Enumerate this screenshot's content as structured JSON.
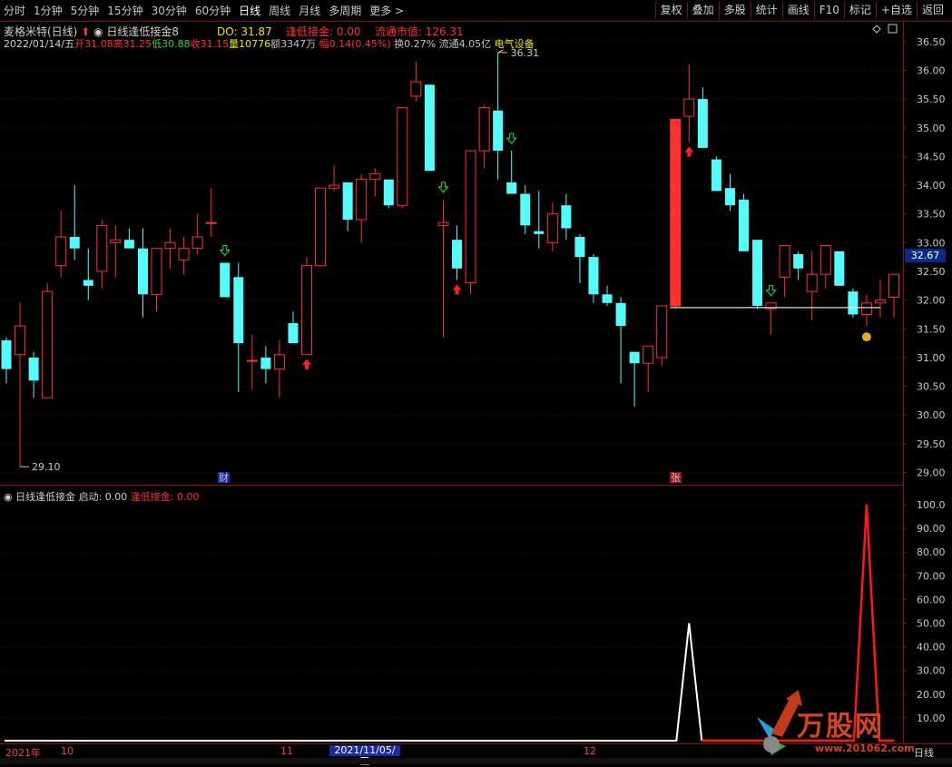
{
  "toolbar": {
    "left_items": [
      "分时",
      "1分钟",
      "5分钟",
      "15分钟",
      "30分钟",
      "60分钟",
      "日线",
      "周线",
      "月线",
      "多周期",
      "更多 >"
    ],
    "active": "日线",
    "right_items": [
      "复权",
      "叠加",
      "多股",
      "统计",
      "画线",
      "F10",
      "标记",
      "+自选",
      "返回"
    ]
  },
  "info": {
    "stock_title": "麦格米特(日线)",
    "indicator_name": "日线逢低接金8",
    "do_label": "DO: 31.87",
    "fdjj_label": "逢低接金: 0.00",
    "mktcap_label": "流通市值: 126.31",
    "date": "2022/01/14/五",
    "open": "开31.08",
    "high": "高31.25",
    "low": "低30.88",
    "close": "收31.15",
    "volume": "量10776",
    "amount": "额3347万",
    "change": "幅0.14(0.45%)",
    "turnover": "换0.27%",
    "float": "流通4.05亿",
    "sector": "电气设备"
  },
  "sub_info": {
    "name": "日线逢低接金",
    "start_label": "启动: 0.00",
    "fdjj_label": "逢低接金: 0.00"
  },
  "price_axis": [
    "36.50",
    "36.00",
    "35.50",
    "35.00",
    "34.50",
    "34.00",
    "33.50",
    "33.00",
    "32.50",
    "32.00",
    "31.50",
    "31.00",
    "30.50",
    "30.00",
    "29.50",
    "29.00"
  ],
  "current_price": "32.67",
  "high_mark": "36.31",
  "low_mark": "29.10",
  "sub_axis": [
    "100.0",
    "90.00",
    "80.00",
    "70.00",
    "60.00",
    "50.00",
    "40.00",
    "30.00",
    "20.00",
    "10.00"
  ],
  "markers": {
    "cai": "财",
    "zhang": "张"
  },
  "date_axis": {
    "year": "2021年",
    "m10": "10",
    "m11": "11",
    "highlight": "2021/11/05/五",
    "m12": "12",
    "period": "日线"
  },
  "watermark": {
    "text": "万股网",
    "url": "www.201062.com"
  },
  "colors": {
    "up": "#ff3030",
    "down": "#54fcfc",
    "grid": "#6a0000"
  },
  "chart_data": {
    "type": "candlestick",
    "ylim": [
      28.85,
      36.75
    ],
    "candles": [
      {
        "o": 31.3,
        "h": 31.35,
        "l": 30.55,
        "c": 30.8
      },
      {
        "o": 31.05,
        "h": 31.95,
        "l": 29.1,
        "c": 31.55
      },
      {
        "o": 31.0,
        "h": 31.1,
        "l": 30.3,
        "c": 30.6
      },
      {
        "o": 30.3,
        "h": 32.3,
        "l": 30.3,
        "c": 32.15
      },
      {
        "o": 32.6,
        "h": 33.55,
        "l": 32.4,
        "c": 33.1
      },
      {
        "o": 33.1,
        "h": 34.0,
        "l": 32.7,
        "c": 32.9
      },
      {
        "o": 32.35,
        "h": 32.9,
        "l": 32.0,
        "c": 32.25
      },
      {
        "o": 32.5,
        "h": 33.4,
        "l": 32.2,
        "c": 33.3
      },
      {
        "o": 33.0,
        "h": 33.3,
        "l": 32.4,
        "c": 33.05
      },
      {
        "o": 33.05,
        "h": 33.25,
        "l": 32.9,
        "c": 32.9
      },
      {
        "o": 32.9,
        "h": 33.25,
        "l": 31.7,
        "c": 32.1
      },
      {
        "o": 32.1,
        "h": 32.8,
        "l": 31.8,
        "c": 32.9
      },
      {
        "o": 32.9,
        "h": 33.25,
        "l": 32.55,
        "c": 33.0
      },
      {
        "o": 32.7,
        "h": 33.1,
        "l": 32.45,
        "c": 32.9
      },
      {
        "o": 32.9,
        "h": 33.5,
        "l": 32.8,
        "c": 33.1
      },
      {
        "o": 33.35,
        "h": 33.95,
        "l": 33.1,
        "c": 33.35
      },
      {
        "o": 32.65,
        "h": 32.65,
        "l": 32.05,
        "c": 32.05
      },
      {
        "o": 32.4,
        "h": 32.65,
        "l": 30.4,
        "c": 31.25
      },
      {
        "o": 30.95,
        "h": 31.4,
        "l": 30.45,
        "c": 30.95
      },
      {
        "o": 31.0,
        "h": 31.2,
        "l": 30.55,
        "c": 30.8
      },
      {
        "o": 30.8,
        "h": 31.3,
        "l": 30.3,
        "c": 31.05
      },
      {
        "o": 31.6,
        "h": 31.8,
        "l": 31.35,
        "c": 31.25
      },
      {
        "o": 31.05,
        "h": 32.75,
        "l": 31.05,
        "c": 32.6
      },
      {
        "o": 32.6,
        "h": 33.95,
        "l": 32.6,
        "c": 33.95
      },
      {
        "o": 33.95,
        "h": 34.35,
        "l": 33.9,
        "c": 34.0
      },
      {
        "o": 34.05,
        "h": 34.05,
        "l": 33.2,
        "c": 33.4
      },
      {
        "o": 33.4,
        "h": 34.2,
        "l": 33.0,
        "c": 34.1
      },
      {
        "o": 34.1,
        "h": 34.3,
        "l": 33.8,
        "c": 34.2
      },
      {
        "o": 34.1,
        "h": 34.1,
        "l": 33.6,
        "c": 33.65
      },
      {
        "o": 33.65,
        "h": 34.5,
        "l": 33.6,
        "c": 35.35
      },
      {
        "o": 35.55,
        "h": 36.15,
        "l": 35.45,
        "c": 35.8
      },
      {
        "o": 35.75,
        "h": 35.75,
        "l": 34.25,
        "c": 34.25
      },
      {
        "o": 33.3,
        "h": 33.75,
        "l": 31.35,
        "c": 33.35
      },
      {
        "o": 33.05,
        "h": 33.3,
        "l": 32.35,
        "c": 32.55
      },
      {
        "o": 32.3,
        "h": 33.5,
        "l": 32.1,
        "c": 34.6
      },
      {
        "o": 34.6,
        "h": 35.4,
        "l": 34.3,
        "c": 35.35
      },
      {
        "o": 35.3,
        "h": 36.31,
        "l": 34.1,
        "c": 34.6
      },
      {
        "o": 34.05,
        "h": 34.6,
        "l": 33.9,
        "c": 33.85
      },
      {
        "o": 33.85,
        "h": 34.0,
        "l": 33.15,
        "c": 33.3
      },
      {
        "o": 33.2,
        "h": 33.9,
        "l": 32.9,
        "c": 33.15
      },
      {
        "o": 33.0,
        "h": 33.7,
        "l": 32.85,
        "c": 33.5
      },
      {
        "o": 33.65,
        "h": 33.85,
        "l": 33.05,
        "c": 33.25
      },
      {
        "o": 33.1,
        "h": 33.15,
        "l": 32.3,
        "c": 32.75
      },
      {
        "o": 32.75,
        "h": 32.8,
        "l": 31.95,
        "c": 32.1
      },
      {
        "o": 32.1,
        "h": 32.25,
        "l": 31.9,
        "c": 31.95
      },
      {
        "o": 31.95,
        "h": 32.05,
        "l": 30.55,
        "c": 31.55
      },
      {
        "o": 31.1,
        "h": 31.1,
        "l": 30.15,
        "c": 30.9
      },
      {
        "o": 30.9,
        "h": 31.2,
        "l": 30.4,
        "c": 31.2
      },
      {
        "o": 31.0,
        "h": 31.75,
        "l": 30.85,
        "c": 31.9
      },
      {
        "o": 31.9,
        "h": 35.15,
        "l": 31.85,
        "c": 35.15
      },
      {
        "o": 35.2,
        "h": 36.1,
        "l": 34.75,
        "c": 35.5
      },
      {
        "o": 35.5,
        "h": 35.7,
        "l": 34.65,
        "c": 34.65
      },
      {
        "o": 34.45,
        "h": 34.5,
        "l": 33.9,
        "c": 33.9
      },
      {
        "o": 33.95,
        "h": 34.2,
        "l": 33.55,
        "c": 33.65
      },
      {
        "o": 33.75,
        "h": 33.85,
        "l": 32.85,
        "c": 32.85
      },
      {
        "o": 33.05,
        "h": 33.05,
        "l": 31.85,
        "c": 31.9
      },
      {
        "o": 31.85,
        "h": 31.95,
        "l": 31.4,
        "c": 31.95
      },
      {
        "o": 32.4,
        "h": 32.75,
        "l": 32.05,
        "c": 32.95
      },
      {
        "o": 32.8,
        "h": 32.85,
        "l": 32.35,
        "c": 32.55
      },
      {
        "o": 32.15,
        "h": 32.85,
        "l": 31.65,
        "c": 32.45
      },
      {
        "o": 32.45,
        "h": 32.95,
        "l": 32.2,
        "c": 32.95
      },
      {
        "o": 32.85,
        "h": 32.85,
        "l": 32.25,
        "c": 32.25
      },
      {
        "o": 32.15,
        "h": 32.2,
        "l": 31.7,
        "c": 31.75
      },
      {
        "o": 31.75,
        "h": 32.1,
        "l": 31.55,
        "c": 31.95
      },
      {
        "o": 31.95,
        "h": 32.35,
        "l": 31.7,
        "c": 32.0
      },
      {
        "o": 32.05,
        "h": 32.45,
        "l": 31.7,
        "c": 32.45
      }
    ],
    "buy_signals": [
      22,
      33,
      50
    ],
    "sell_signals": [
      16,
      32,
      37,
      56
    ],
    "support_line": {
      "value": 31.87,
      "from": 49,
      "to": 64
    },
    "indicator": {
      "white_peak": {
        "index": 50,
        "value": 50
      },
      "red_peak": {
        "index": 63,
        "value": 100
      }
    }
  }
}
